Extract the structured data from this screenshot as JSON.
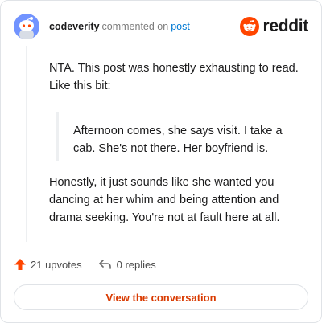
{
  "header": {
    "username": "codeverity",
    "action_text": "commented on",
    "post_link": "post",
    "brand_name": "reddit",
    "brand_color": "#ff4500"
  },
  "comment": {
    "paragraph_1": "NTA. This post was honestly exhausting to read. Like this bit:",
    "quote": "Afternoon comes, she says visit. I take a cab. She's not there. Her boyfriend is.",
    "paragraph_2": "Honestly, it just sounds like she wanted you dancing at her whim and being attention and drama seeking. You're not at fault here at all."
  },
  "actions": {
    "upvotes": "21 upvotes",
    "replies": "0 replies",
    "upvote_icon": "upvote-arrow-icon",
    "reply_icon": "reply-arrow-icon",
    "upvote_color": "#ff4500"
  },
  "cta": {
    "label": "View the conversation",
    "color": "#d93a00"
  }
}
